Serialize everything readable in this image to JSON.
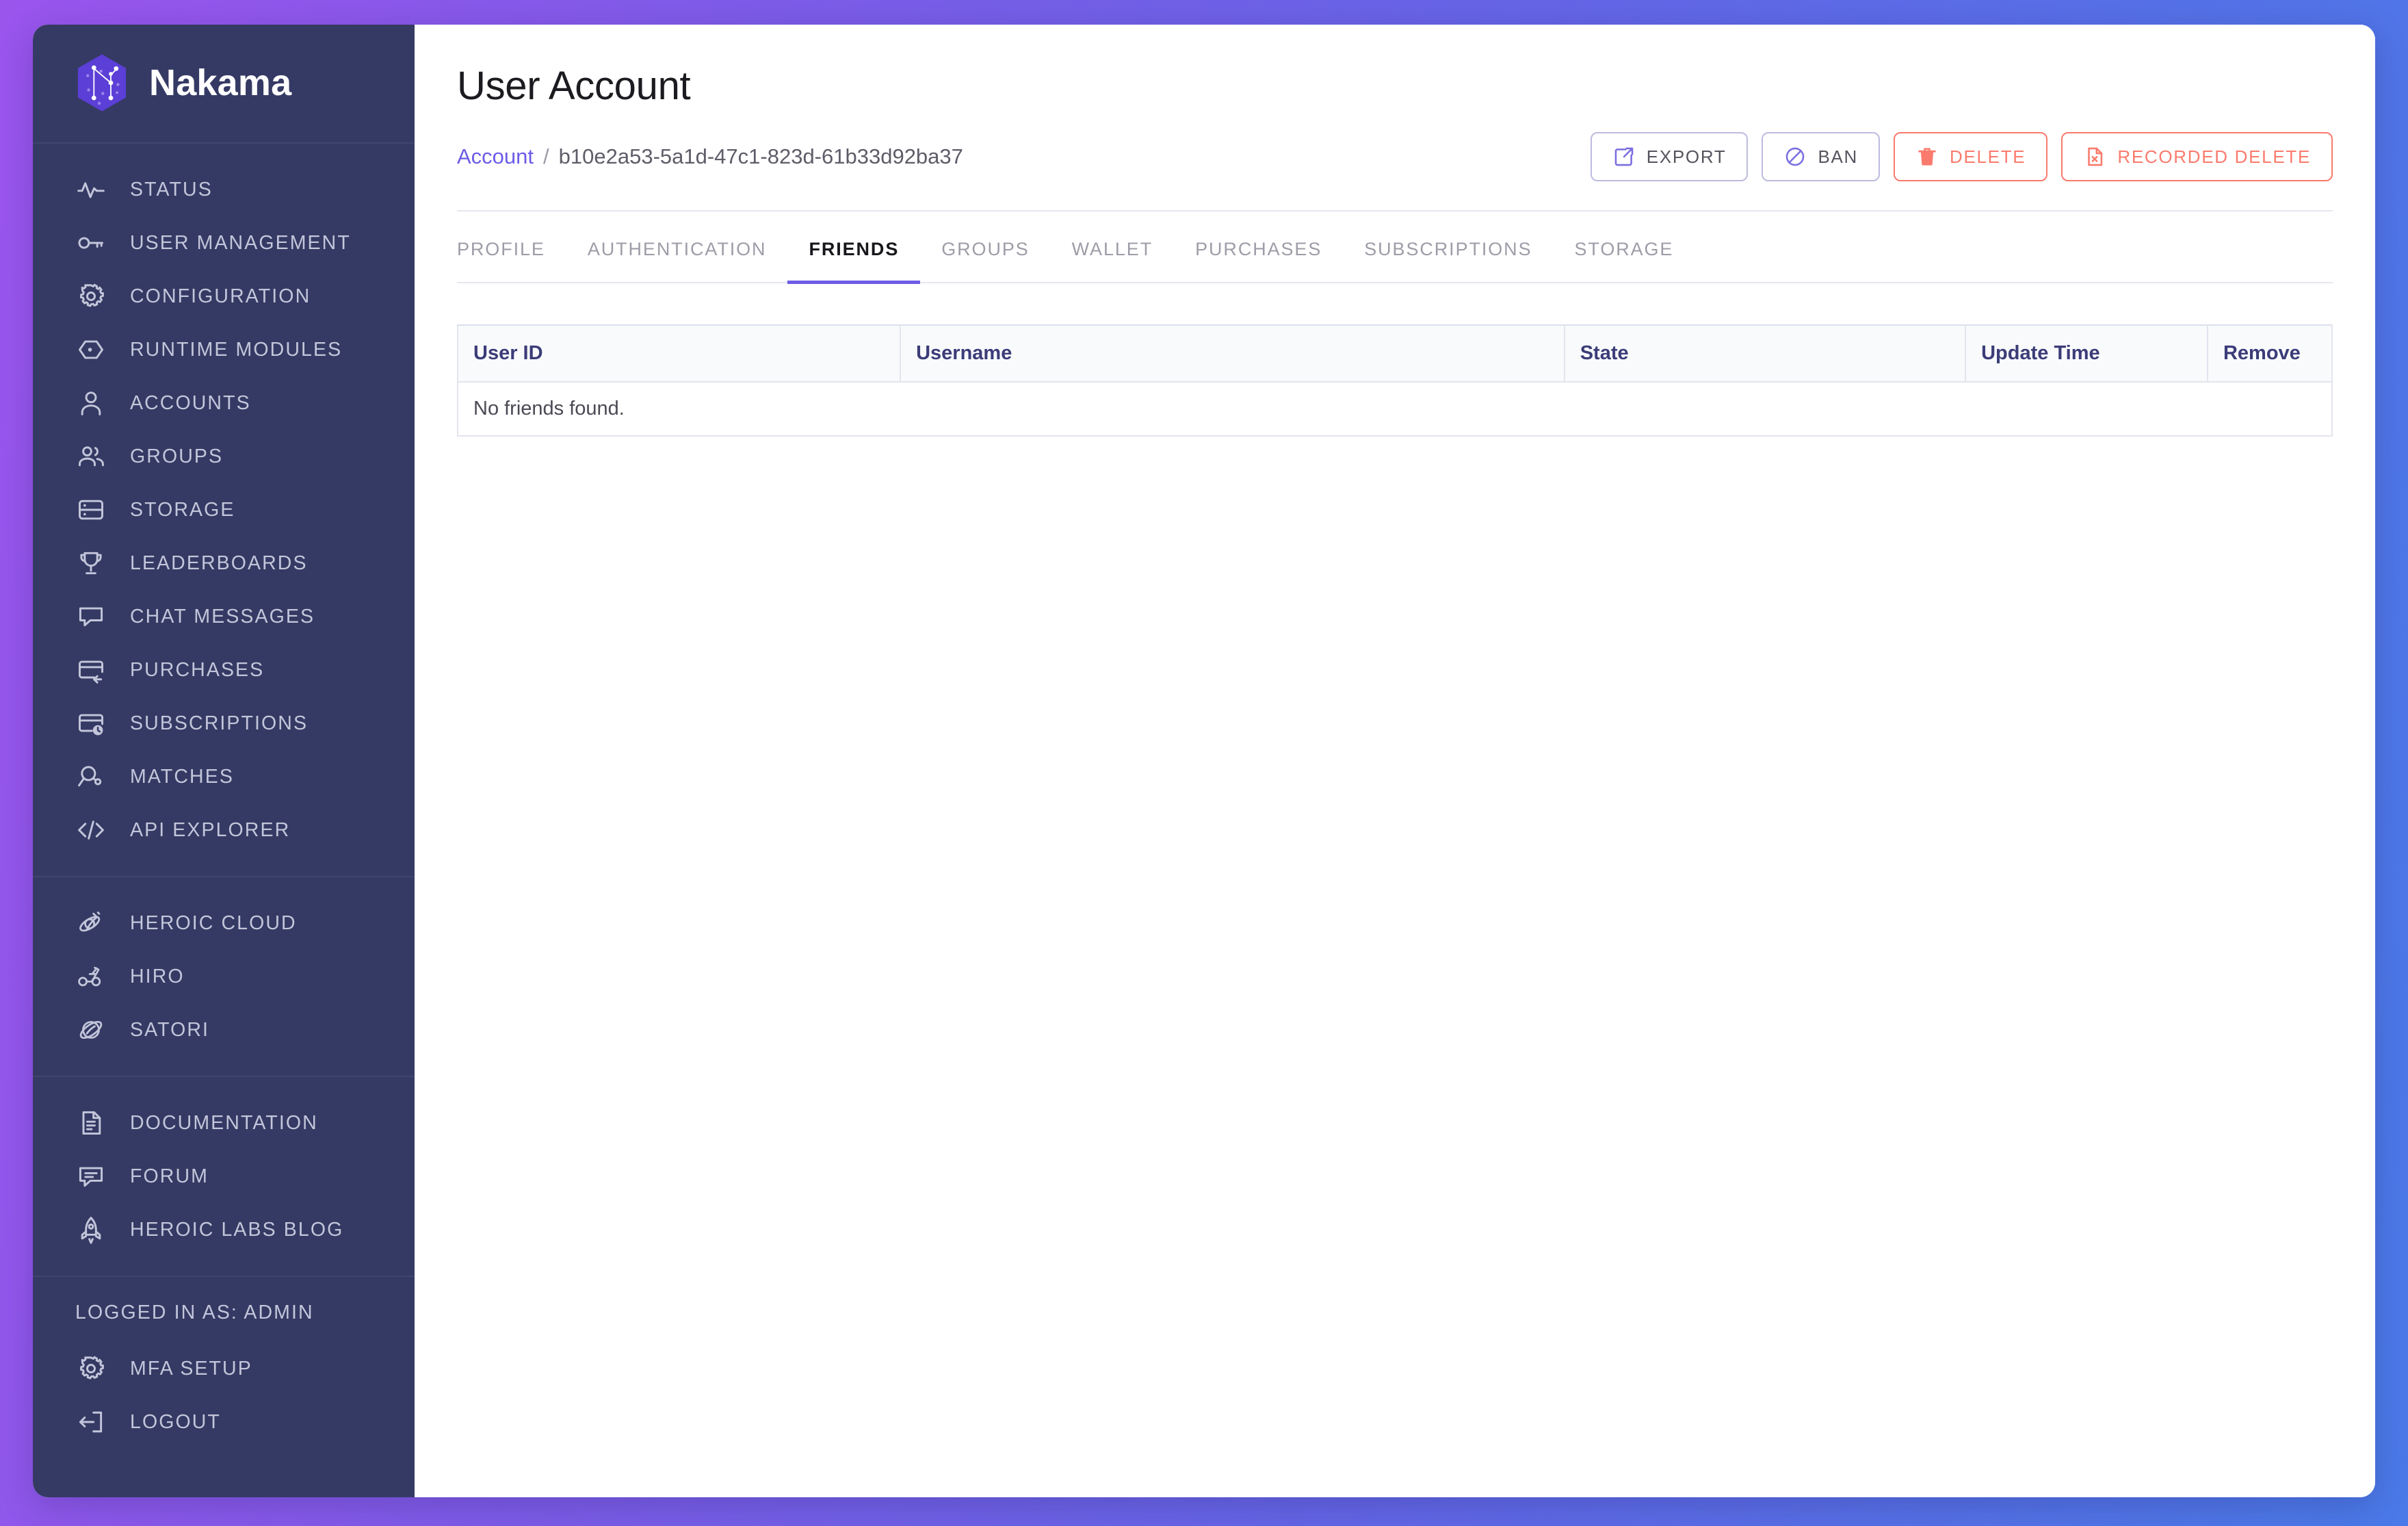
{
  "brand": {
    "name": "Nakama",
    "logo_icon": "nakama-hexagon-logo"
  },
  "sidebar": {
    "sections": [
      {
        "id": "primary",
        "items": [
          {
            "label": "STATUS",
            "icon": "activity-pulse-icon"
          },
          {
            "label": "USER MANAGEMENT",
            "icon": "key-icon"
          },
          {
            "label": "CONFIGURATION",
            "icon": "gear-icon"
          },
          {
            "label": "RUNTIME MODULES",
            "icon": "hexagon-dot-icon"
          },
          {
            "label": "ACCOUNTS",
            "icon": "user-icon"
          },
          {
            "label": "GROUPS",
            "icon": "users-group-icon"
          },
          {
            "label": "STORAGE",
            "icon": "database-icon"
          },
          {
            "label": "LEADERBOARDS",
            "icon": "trophy-icon"
          },
          {
            "label": "CHAT MESSAGES",
            "icon": "chat-bubble-icon"
          },
          {
            "label": "PURCHASES",
            "icon": "credit-card-arrow-icon"
          },
          {
            "label": "SUBSCRIPTIONS",
            "icon": "credit-card-clock-icon"
          },
          {
            "label": "MATCHES",
            "icon": "search-user-icon"
          },
          {
            "label": "API EXPLORER",
            "icon": "code-brackets-icon"
          }
        ]
      },
      {
        "id": "products",
        "items": [
          {
            "label": "HEROIC CLOUD",
            "icon": "heroic-cloud-icon"
          },
          {
            "label": "HIRO",
            "icon": "hiro-icon"
          },
          {
            "label": "SATORI",
            "icon": "satori-icon"
          }
        ]
      },
      {
        "id": "resources",
        "items": [
          {
            "label": "DOCUMENTATION",
            "icon": "document-icon"
          },
          {
            "label": "FORUM",
            "icon": "forum-chat-icon"
          },
          {
            "label": "HEROIC LABS BLOG",
            "icon": "rocket-icon"
          }
        ]
      }
    ],
    "account": {
      "logged_in_as": "LOGGED IN AS: ADMIN",
      "items": [
        {
          "label": "MFA SETUP",
          "icon": "gear-icon"
        },
        {
          "label": "LOGOUT",
          "icon": "logout-arrow-icon"
        }
      ]
    }
  },
  "header": {
    "title": "User Account",
    "breadcrumb": {
      "parent": "Account",
      "separator": "/",
      "current": "b10e2a53-5a1d-47c1-823d-61b33d92ba37"
    },
    "actions": [
      {
        "label": "EXPORT",
        "icon": "external-link-icon",
        "style": "neutral"
      },
      {
        "label": "BAN",
        "icon": "ban-circle-slash-icon",
        "style": "neutral"
      },
      {
        "label": "DELETE",
        "icon": "trash-icon",
        "style": "danger"
      },
      {
        "label": "RECORDED DELETE",
        "icon": "file-x-icon",
        "style": "danger"
      }
    ]
  },
  "tabs": [
    {
      "label": "PROFILE",
      "active": false
    },
    {
      "label": "AUTHENTICATION",
      "active": false
    },
    {
      "label": "FRIENDS",
      "active": true
    },
    {
      "label": "GROUPS",
      "active": false
    },
    {
      "label": "WALLET",
      "active": false
    },
    {
      "label": "PURCHASES",
      "active": false
    },
    {
      "label": "SUBSCRIPTIONS",
      "active": false
    },
    {
      "label": "STORAGE",
      "active": false
    }
  ],
  "friends_table": {
    "columns": [
      "User ID",
      "Username",
      "State",
      "Update Time",
      "Remove"
    ],
    "rows": [],
    "empty_message": "No friends found."
  },
  "colors": {
    "sidebar_bg": "#353a64",
    "accent": "#6c5ce7",
    "danger": "#fa7b6e",
    "link": "#6c5ce7",
    "table_header_text": "#3b3c78",
    "gradient_start": "#9a55ed",
    "gradient_end": "#4a7ae8"
  }
}
